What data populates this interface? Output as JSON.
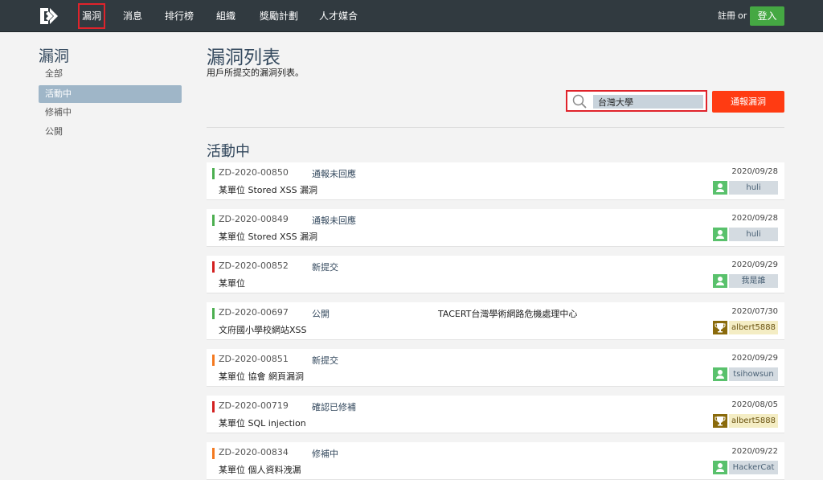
{
  "nav": {
    "items": [
      {
        "label": "漏洞",
        "active": true
      },
      {
        "label": "消息",
        "active": false
      },
      {
        "label": "排行榜",
        "active": false
      },
      {
        "label": "組織",
        "active": false
      },
      {
        "label": "獎勵計劃",
        "active": false
      },
      {
        "label": "人才媒合",
        "active": false
      }
    ],
    "register": "註冊",
    "or": "or",
    "login": "登入"
  },
  "sidebar": {
    "title": "漏洞",
    "items": [
      {
        "label": "全部",
        "active": false
      },
      {
        "label": "活動中",
        "active": true
      },
      {
        "label": "修補中",
        "active": false
      },
      {
        "label": "公開",
        "active": false
      }
    ]
  },
  "main": {
    "title": "漏洞列表",
    "subtitle": "用戶所提交的漏洞列表。",
    "search_value": "台灣大學",
    "report_button": "通報漏洞",
    "section_title": "活動中",
    "colors": {
      "green": "#4caf50",
      "red": "#d32020",
      "orange": "#f47920"
    },
    "entries": [
      {
        "id": "ZD-2020-00850",
        "status": "通報未回應",
        "vendor": "",
        "date": "2020/09/28",
        "title": "某單位 Stored XSS 漏洞",
        "user": "huli",
        "user_tier": "basic",
        "severity_color": "#4caf50"
      },
      {
        "id": "ZD-2020-00849",
        "status": "通報未回應",
        "vendor": "",
        "date": "2020/09/28",
        "title": "某單位 Stored XSS 漏洞",
        "user": "huli",
        "user_tier": "basic",
        "severity_color": "#4caf50"
      },
      {
        "id": "ZD-2020-00852",
        "status": "新提交",
        "vendor": "",
        "date": "2020/09/29",
        "title": "某單位",
        "user": "我是誰",
        "user_tier": "basic",
        "severity_color": "#d32020"
      },
      {
        "id": "ZD-2020-00697",
        "status": "公開",
        "vendor": "TACERT台灣學術網路危機處理中心",
        "date": "2020/07/30",
        "title": "文府國小學校網站XSS",
        "user": "albert5888",
        "user_tier": "gold",
        "severity_color": "#4caf50"
      },
      {
        "id": "ZD-2020-00851",
        "status": "新提交",
        "vendor": "",
        "date": "2020/09/29",
        "title": "某單位 協會 網頁漏洞",
        "user": "tsihowsun",
        "user_tier": "basic",
        "severity_color": "#f47920"
      },
      {
        "id": "ZD-2020-00719",
        "status": "確認已修補",
        "vendor": "",
        "date": "2020/08/05",
        "title": "某單位 SQL injection",
        "user": "albert5888",
        "user_tier": "gold",
        "severity_color": "#d32020"
      },
      {
        "id": "ZD-2020-00834",
        "status": "修補中",
        "vendor": "",
        "date": "2020/09/22",
        "title": "某單位 個人資料洩漏",
        "user": "HackerCat",
        "user_tier": "basic",
        "severity_color": "#f47920"
      }
    ]
  }
}
